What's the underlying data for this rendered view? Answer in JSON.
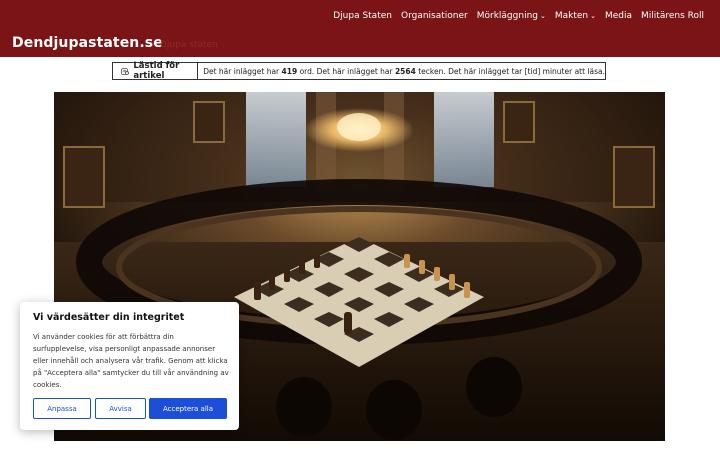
{
  "header": {
    "site_title": "Dendjupastaten.se",
    "tagline": "Djupa staten",
    "nav": [
      {
        "label": "Djupa Staten",
        "has_dropdown": false
      },
      {
        "label": "Organisationer",
        "has_dropdown": false
      },
      {
        "label": "Mörkläggning",
        "has_dropdown": true
      },
      {
        "label": "Makten",
        "has_dropdown": true
      },
      {
        "label": "Media",
        "has_dropdown": false
      },
      {
        "label": "Militärens Roll",
        "has_dropdown": false
      }
    ]
  },
  "reading": {
    "label": "Lästid för artikel",
    "p1": "Det här inlägget har ",
    "words": "419",
    "p2": " ord. Det här inlägget har ",
    "chars": "2564",
    "p3": " tecken. Det här inlägget tar [tid] minuter att läsa."
  },
  "cookie": {
    "title": "Vi värdesätter din integritet",
    "body": "Vi använder cookies för att förbättra din surfupplevelse, visa personligt anpassade annonser eller innehåll och analysera vår trafik. Genom att klicka på \"Acceptera alla\" samtycker du till vår användning av cookies.",
    "customize": "Anpassa",
    "reject": "Avvisa",
    "accept": "Acceptera alla"
  },
  "colors": {
    "header_bg": "#7a1416",
    "accent": "#1d4ed8"
  }
}
